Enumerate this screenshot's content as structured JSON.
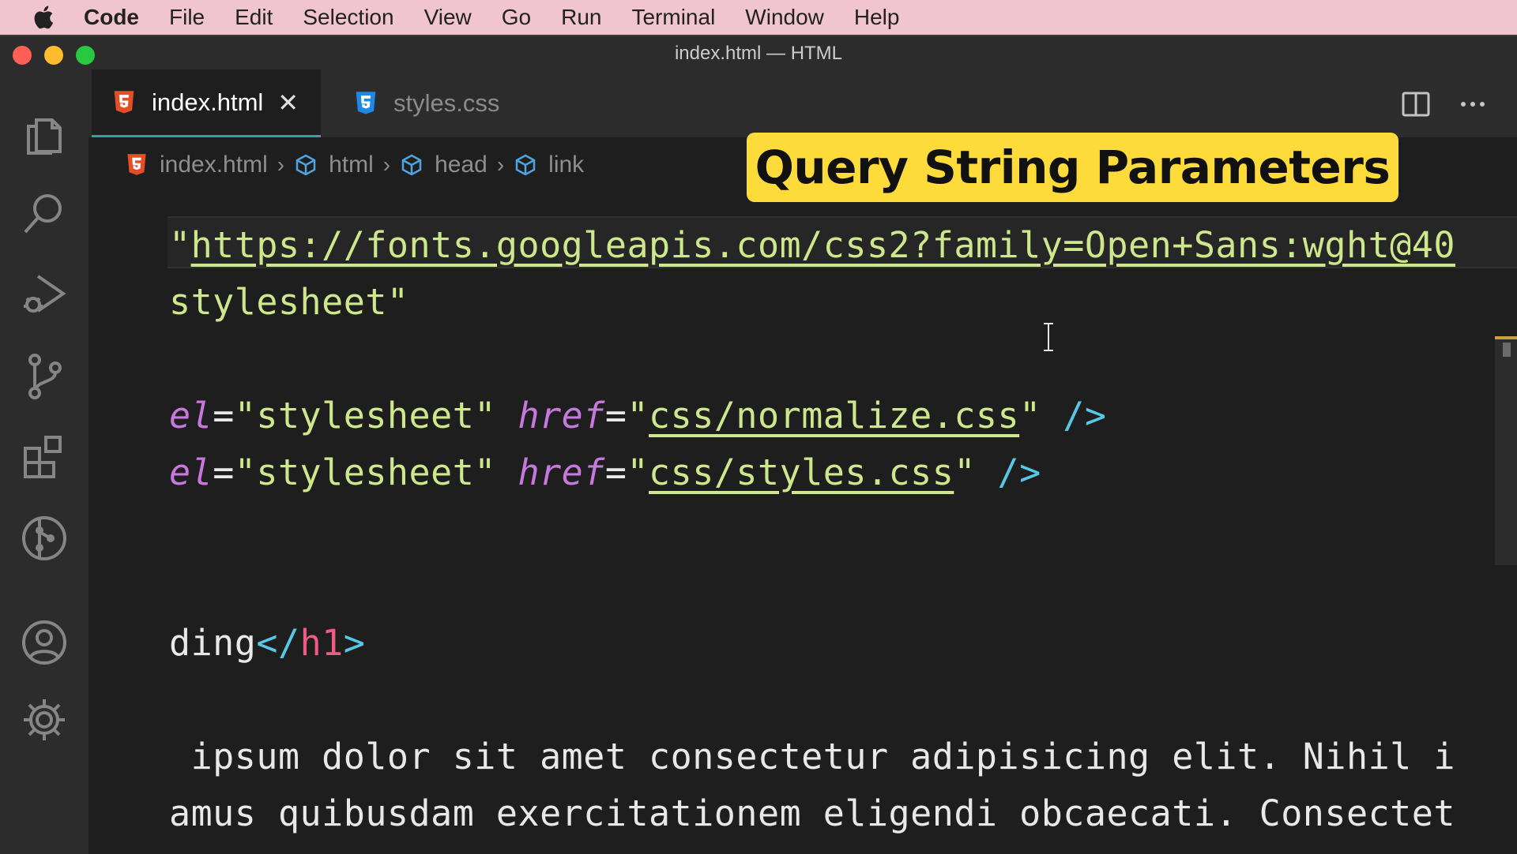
{
  "menubar": {
    "apple_icon": "apple-icon",
    "app": "Code",
    "items": [
      "File",
      "Edit",
      "Selection",
      "View",
      "Go",
      "Run",
      "Terminal",
      "Window",
      "Help"
    ]
  },
  "window": {
    "title": "index.html — HTML"
  },
  "tabs": [
    {
      "label": "index.html",
      "icon": "html5-icon",
      "active": true,
      "close": "✕"
    },
    {
      "label": "styles.css",
      "icon": "css3-icon",
      "active": false
    }
  ],
  "breadcrumb": [
    "index.html",
    "html",
    "head",
    "link"
  ],
  "overlay": {
    "title": "Query String Parameters"
  },
  "code_lines": [
    [
      {
        "t": "\"",
        "c": "str"
      },
      {
        "t": "https://fonts.googleapis.com/css2?family=Open+Sans:wght@40",
        "c": "strU"
      }
    ],
    [
      {
        "t": "stylesheet\"",
        "c": "str"
      }
    ],
    [],
    [
      {
        "t": "el",
        "c": "attr"
      },
      {
        "t": "=",
        "c": "plain"
      },
      {
        "t": "\"stylesheet\"",
        "c": "str"
      },
      {
        "t": " ",
        "c": "plain"
      },
      {
        "t": "href",
        "c": "attr"
      },
      {
        "t": "=",
        "c": "plain"
      },
      {
        "t": "\"",
        "c": "str"
      },
      {
        "t": "css/normalize.css",
        "c": "strU"
      },
      {
        "t": "\"",
        "c": "str"
      },
      {
        "t": " />",
        "c": "pun"
      }
    ],
    [
      {
        "t": "el",
        "c": "attr"
      },
      {
        "t": "=",
        "c": "plain"
      },
      {
        "t": "\"stylesheet\"",
        "c": "str"
      },
      {
        "t": " ",
        "c": "plain"
      },
      {
        "t": "href",
        "c": "attr"
      },
      {
        "t": "=",
        "c": "plain"
      },
      {
        "t": "\"",
        "c": "str"
      },
      {
        "t": "css/styles.css",
        "c": "strU"
      },
      {
        "t": "\"",
        "c": "str"
      },
      {
        "t": " />",
        "c": "pun"
      }
    ],
    [],
    [],
    [
      {
        "t": "ding",
        "c": "plain"
      },
      {
        "t": "</",
        "c": "pun"
      },
      {
        "t": "h1",
        "c": "tag"
      },
      {
        "t": ">",
        "c": "pun"
      }
    ],
    [],
    [
      {
        "t": " ipsum dolor sit amet consectetur adipisicing elit. Nihil i",
        "c": "plain"
      }
    ],
    [
      {
        "t": "amus quibusdam exercitationem eligendi obcaecati. Consectet",
        "c": "plain"
      }
    ]
  ],
  "colors": {
    "accent_tab_border": "#2ea6a0",
    "banner": "#fddb3b",
    "string": "#cde88c",
    "attribute": "#c678dd",
    "tag": "#ef5b82",
    "punctuation": "#56c8e6"
  }
}
